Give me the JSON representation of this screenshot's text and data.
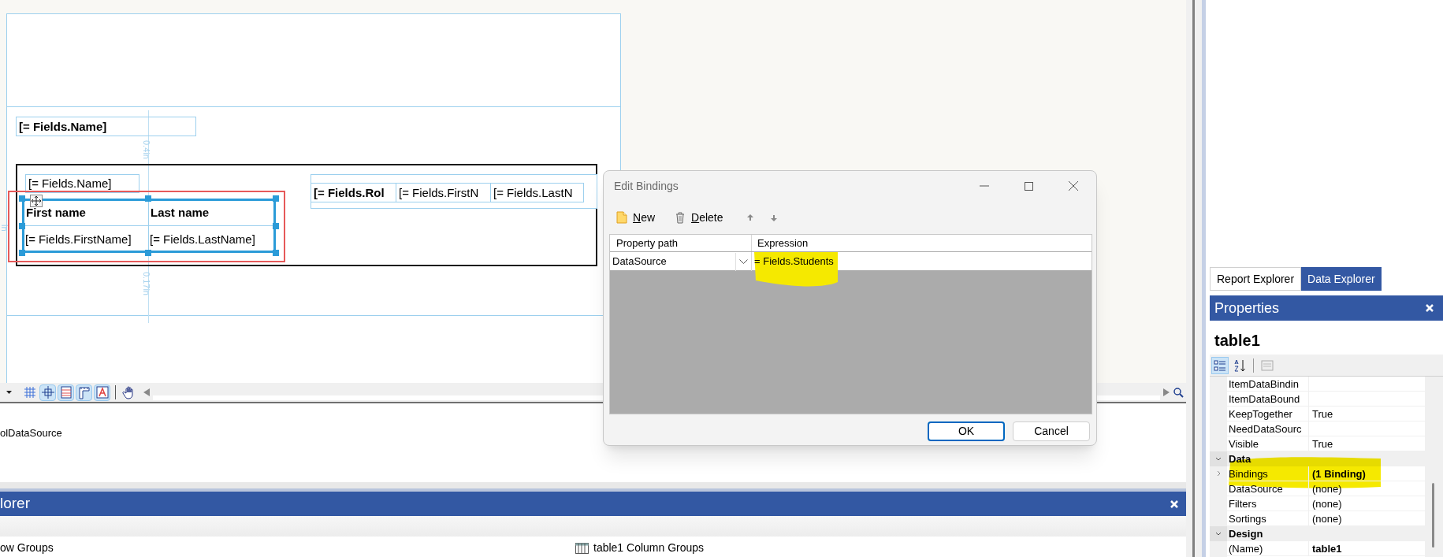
{
  "report_designer": {
    "header_textbox": "[= Fields.Name]",
    "guide_labels": [
      "0.4in",
      "0.17in",
      "in"
    ],
    "list": {
      "name_textbox": "[= Fields.Name]",
      "table": {
        "selected": true,
        "columns": [
          "First name",
          "Last name"
        ],
        "cells": [
          "[= Fields.FirstName]",
          "[= Fields.LastName]"
        ]
      },
      "side_table": {
        "cells": [
          {
            "text": "[= Fields.Rol",
            "bold": true
          },
          {
            "text": "[= Fields.FirstN",
            "bold": false
          },
          {
            "text": "[= Fields.LastN",
            "bold": false
          }
        ]
      }
    }
  },
  "designer_toolbar": {
    "buttons": [
      {
        "kind": "grid",
        "selected": false
      },
      {
        "kind": "snap",
        "selected": true
      },
      {
        "kind": "lines",
        "selected": true
      },
      {
        "kind": "dimensions",
        "selected": true
      },
      {
        "kind": "text",
        "selected": true
      },
      {
        "kind": "hand",
        "selected": false
      }
    ]
  },
  "components_tray": {
    "items": [
      "olDataSource"
    ]
  },
  "explorer_panel": {
    "title": "lorer",
    "groups": [
      {
        "kind": "row",
        "label": "ow Groups"
      },
      {
        "kind": "column",
        "label": "table1 Column Groups"
      }
    ]
  },
  "dialog": {
    "title": "Edit Bindings",
    "toolbar": [
      {
        "kind": "new",
        "label": "New"
      },
      {
        "kind": "delete",
        "label": "Delete"
      },
      {
        "kind": "up"
      },
      {
        "kind": "down"
      }
    ],
    "columns": [
      "Property path",
      "Expression"
    ],
    "rows": [
      {
        "property_path": "DataSource",
        "expression": "= Fields.Students"
      }
    ],
    "buttons": [
      {
        "label": "OK",
        "default": true
      },
      {
        "label": "Cancel",
        "default": false
      }
    ]
  },
  "right_panel": {
    "tabs": [
      {
        "label": "Report Explorer",
        "selected": false
      },
      {
        "label": "Data Explorer",
        "selected": true
      }
    ],
    "properties": {
      "title": "Properties",
      "object": "table1",
      "toolbar": [
        {
          "kind": "categorized",
          "selected": true
        },
        {
          "kind": "alphabetical",
          "selected": false
        },
        {
          "kind": "pages",
          "selected": false
        }
      ],
      "rows": [
        {
          "kind": "property",
          "name": "ItemDataBindin"
        },
        {
          "kind": "property",
          "name": "ItemDataBound"
        },
        {
          "kind": "property",
          "name": "KeepTogether",
          "value": "True"
        },
        {
          "kind": "property",
          "name": "NeedDataSourc"
        },
        {
          "kind": "property",
          "name": "Visible",
          "value": "True"
        },
        {
          "kind": "category",
          "name": "Data",
          "expanded": true
        },
        {
          "kind": "property",
          "name": "Bindings",
          "value": "(1 Binding)",
          "bold": true,
          "expandable": true
        },
        {
          "kind": "property",
          "name": "DataSource",
          "value": "(none)"
        },
        {
          "kind": "property",
          "name": "Filters",
          "value": "(none)"
        },
        {
          "kind": "property",
          "name": "Sortings",
          "value": "(none)"
        },
        {
          "kind": "category",
          "name": "Design",
          "expanded": true
        },
        {
          "kind": "property",
          "name": "(Name)",
          "value": "table1",
          "bold": true
        }
      ]
    }
  }
}
